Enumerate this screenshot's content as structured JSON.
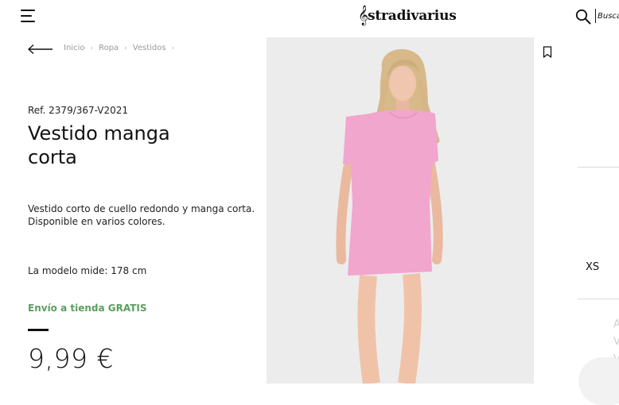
{
  "header": {
    "logo_text": "stradivarius",
    "logo_clef": "𝄞",
    "search_placeholder": "Busca"
  },
  "breadcrumb": [
    "Inicio",
    "Ropa",
    "Vestidos"
  ],
  "product": {
    "ref": "Ref. 2379/367-V2021",
    "title": "Vestido manga corta",
    "description": "Vestido corto de cuello redondo y manga corta. Disponible en varios colores.",
    "model_info": "La modelo mide: 178 cm",
    "shipping": "Envío a tienda GRATIS",
    "price": "9,99 €",
    "dress_color": "#f1a6cd"
  },
  "sizes": {
    "visible_size": "XS"
  },
  "icons": {
    "menu": "hamburger-menu-icon",
    "search": "search-icon",
    "back": "back-arrow-icon",
    "bookmark": "bookmark-icon",
    "chevron": "chevron-right-icon"
  }
}
